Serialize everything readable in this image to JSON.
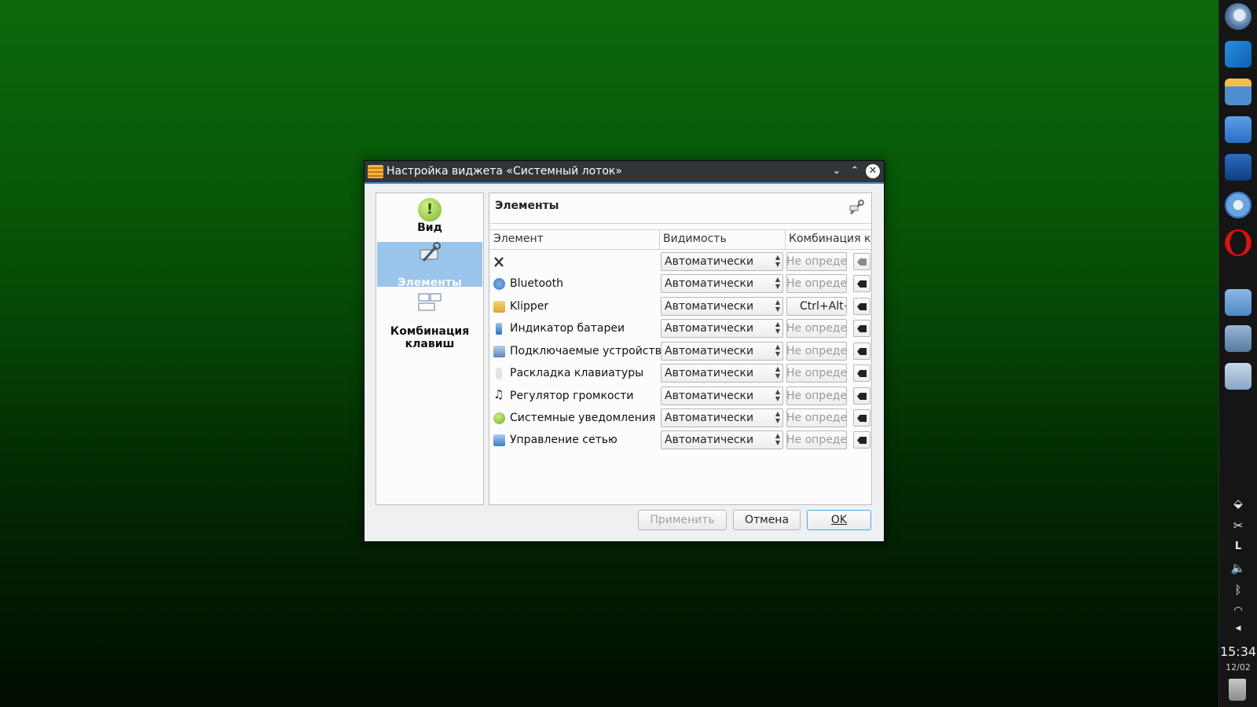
{
  "dialog": {
    "title": "Настройка виджета «Системный лоток»",
    "sidebar": [
      {
        "label": "Вид",
        "icon": "notification-icon",
        "selected": false
      },
      {
        "label": "Элементы",
        "icon": "tools-icon",
        "selected": true
      },
      {
        "label_line1": "Комбинация",
        "label_line2": "клавиш",
        "icon": "keyboard-shortcuts-icon",
        "selected": false
      }
    ],
    "content_title": "Элементы",
    "columns": [
      "Элемент",
      "Видимость",
      "Комбинация к"
    ],
    "rows": [
      {
        "label": "",
        "icon": "tools-icon",
        "visibility": "Автоматически",
        "shortcut": "Не определено",
        "shortcut_set": false
      },
      {
        "label": "Bluetooth",
        "icon": "bluetooth-icon",
        "visibility": "Автоматически",
        "shortcut": "Не определено",
        "shortcut_set": false
      },
      {
        "label": "Klipper",
        "icon": "clipboard-icon",
        "visibility": "Автоматически",
        "shortcut": "Ctrl+Alt+V",
        "shortcut_set": true
      },
      {
        "label": "Индикатор батареи",
        "icon": "battery-icon",
        "visibility": "Автоматически",
        "shortcut": "Не определено",
        "shortcut_set": false
      },
      {
        "label": "Подключаемые устройства",
        "icon": "removable-device-icon",
        "visibility": "Автоматически",
        "shortcut": "Не определено",
        "shortcut_set": false
      },
      {
        "label": "Раскладка клавиатуры",
        "icon": "keyboard-layout-icon",
        "visibility": "Автоматически",
        "shortcut": "Не определено",
        "shortcut_set": false
      },
      {
        "label": "Регулятор громкости",
        "icon": "music-note-icon",
        "visibility": "Автоматически",
        "shortcut": "Не определено",
        "shortcut_set": false
      },
      {
        "label": "Системные уведомления",
        "icon": "notification-icon",
        "visibility": "Автоматически",
        "shortcut": "Не определено",
        "shortcut_set": false
      },
      {
        "label": "Управление сетью",
        "icon": "network-icon",
        "visibility": "Автоматически",
        "shortcut": "Не определено",
        "shortcut_set": false
      }
    ],
    "buttons": {
      "apply": "Применить",
      "cancel": "Отмена",
      "ok": "OK"
    }
  },
  "panel": {
    "tray_layout_indicator": "L",
    "clock_time": "15:34",
    "clock_date": "12/02"
  }
}
